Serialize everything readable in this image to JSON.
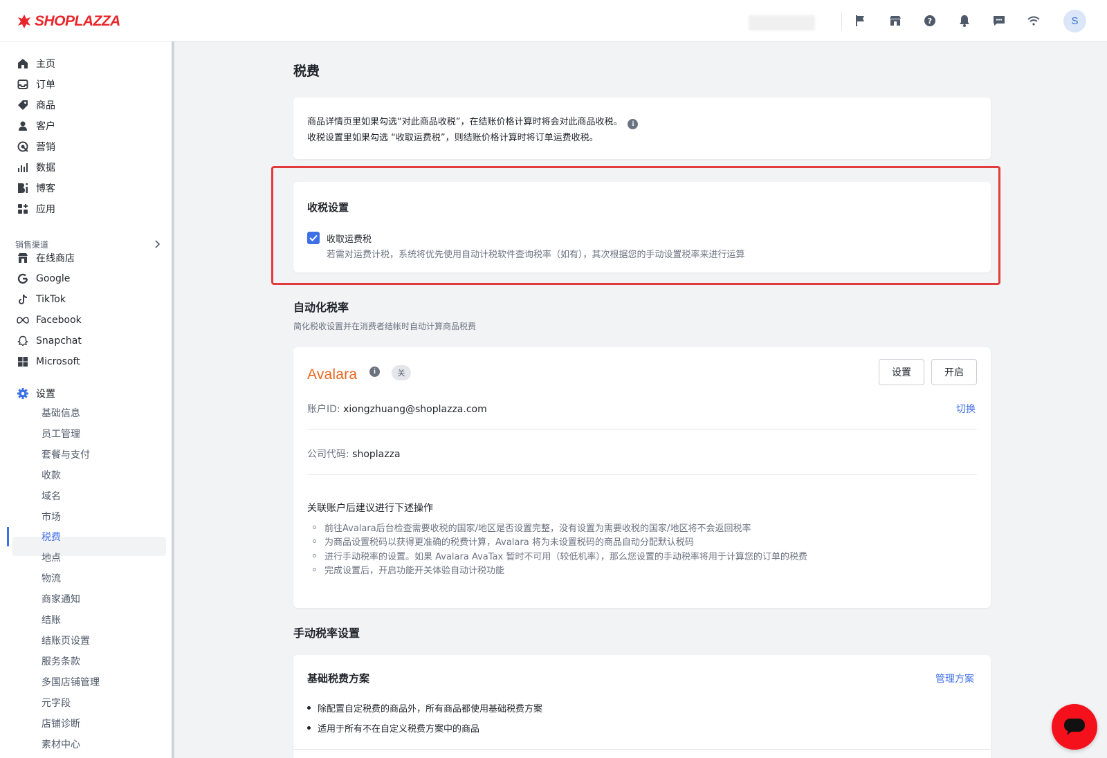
{
  "brand": {
    "name": "SHOPLAZZA",
    "color": "#e8262b"
  },
  "topbar": {
    "avatar_initial": "S",
    "icons": [
      "flag-icon",
      "store-icon",
      "help-icon",
      "bell-icon",
      "message-icon",
      "wifi-icon"
    ]
  },
  "sidebar": {
    "main_items": [
      {
        "label": "主页",
        "icon": "home-icon"
      },
      {
        "label": "订单",
        "icon": "inbox-icon"
      },
      {
        "label": "商品",
        "icon": "tag-icon"
      },
      {
        "label": "客户",
        "icon": "person-icon"
      },
      {
        "label": "营销",
        "icon": "target-icon"
      },
      {
        "label": "数据",
        "icon": "bar-chart-icon"
      },
      {
        "label": "博客",
        "icon": "blog-icon"
      },
      {
        "label": "应用",
        "icon": "apps-icon"
      }
    ],
    "channels_label": "销售渠道",
    "channels": [
      {
        "label": "在线商店",
        "icon": "store-icon"
      },
      {
        "label": "Google",
        "icon": "google-icon"
      },
      {
        "label": "TikTok",
        "icon": "tiktok-icon"
      },
      {
        "label": "Facebook",
        "icon": "meta-icon"
      },
      {
        "label": "Snapchat",
        "icon": "snapchat-icon"
      },
      {
        "label": "Microsoft",
        "icon": "microsoft-icon"
      }
    ],
    "settings_label": "设置",
    "settings_items": [
      "基础信息",
      "员工管理",
      "套餐与支付",
      "收款",
      "域名",
      "市场",
      "税费",
      "地点",
      "物流",
      "商家通知",
      "结账",
      "结账页设置",
      "服务条款",
      "多国店铺管理",
      "元字段",
      "店铺诊断",
      "素材中心"
    ],
    "active_settings_item": "税费",
    "accent_color": "#3d6fe6"
  },
  "main": {
    "page_title": "税费",
    "info": {
      "line1": "商品详情页里如果勾选“对此商品收税”，在结账价格计算时将会对此商品收税。",
      "line2": "收税设置里如果勾选 “收取运费税”，则结账价格计算时将订单运费收税。"
    },
    "tax_settings": {
      "title": "收税设置",
      "checkbox_label": "收取运费税",
      "checkbox_checked": true,
      "checkbox_help": "若需对运费计税，系统将优先使用自动计税软件查询税率（如有），其次根据您的手动设置税率来进行运算"
    },
    "auto_tax": {
      "title": "自动化税率",
      "subtitle": "简化税收设置并在消费者结帐时自动计算商品税费",
      "provider": "Avalara",
      "status_badge": "关",
      "settings_button": "设置",
      "enable_button": "开启",
      "account_label": "账户ID: ",
      "account_value": "xiongzhuang@shoplazza.com",
      "switch_link": "切换",
      "company_label": "公司代码: ",
      "company_value": "shoplazza",
      "steps_title": "关联账户后建议进行下述操作",
      "steps": [
        "前往Avalara后台检查需要收税的国家/地区是否设置完整，没有设置为需要收税的国家/地区将不会返回税率",
        "为商品设置税码以获得更准确的税费计算，Avalara 将为未设置税码的商品自动分配默认税码",
        "进行手动税率的设置。如果 Avalara AvaTax 暂时不可用（较低机率），那么您设置的手动税率将用于计算您的订单的税费",
        "完成设置后，开启功能开关体验自动计税功能"
      ]
    },
    "manual_tax": {
      "title": "手动税率设置",
      "plan_title": "基础税费方案",
      "manage_link": "管理方案",
      "bullets": [
        "除配置自定税费的商品外，所有商品都使用基础税费方案",
        "适用于所有不在自定义税费方案中的商品"
      ]
    }
  },
  "highlight_color": "#e23b3b",
  "chat_button": {
    "icon": "chat-icon",
    "color": "#f5111c"
  }
}
